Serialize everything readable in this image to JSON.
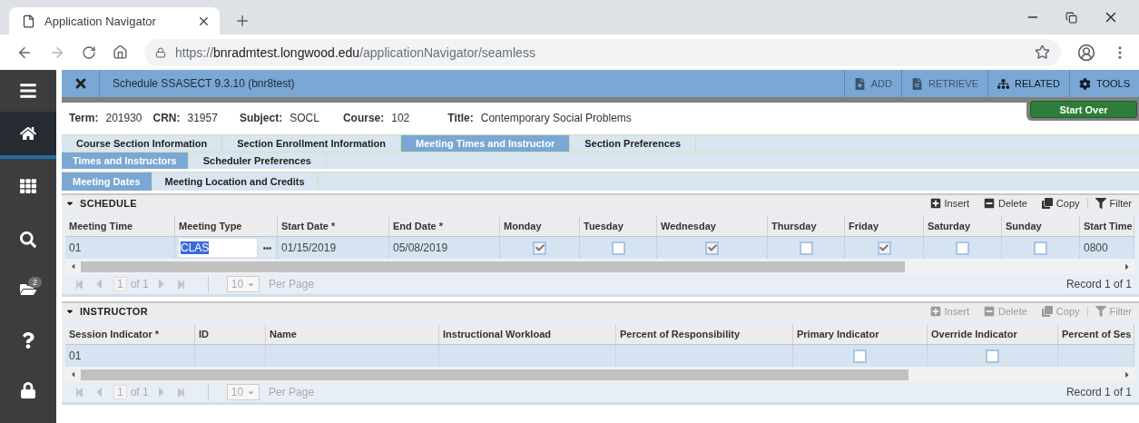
{
  "browser": {
    "tab_title": "Application Navigator",
    "url": {
      "scheme": "https://",
      "host": "bnradmtest.longwood.edu",
      "path": "/applicationNavigator/seamless"
    },
    "forward_disabled": true
  },
  "sidebar": [
    {
      "kind": "menu",
      "selected": false
    },
    {
      "kind": "home",
      "selected": true
    },
    {
      "kind": "apps",
      "selected": false
    },
    {
      "kind": "search",
      "selected": false
    },
    {
      "kind": "recent",
      "selected": false,
      "badge": "2"
    },
    {
      "kind": "help",
      "selected": false
    },
    {
      "kind": "signout",
      "selected": false
    }
  ],
  "app": {
    "title": "Schedule SSASECT 9.3.10 (bnr8test)",
    "actions": [
      {
        "kind": "add",
        "label": "ADD",
        "disabled": true
      },
      {
        "kind": "retrieve",
        "label": "RETRIEVE",
        "disabled": true
      },
      {
        "kind": "related",
        "label": "RELATED",
        "disabled": false
      },
      {
        "kind": "tools",
        "label": "TOOLS",
        "disabled": false
      }
    ]
  },
  "start_over": "Start Over",
  "key_block": [
    {
      "label": "Term:",
      "value": "201930"
    },
    {
      "label": "CRN:",
      "value": "31957"
    },
    {
      "label": "Subject:",
      "value": "SOCL"
    },
    {
      "label": "Course:",
      "value": "102"
    },
    {
      "label": "Title:",
      "value": "Contemporary Social Problems"
    }
  ],
  "tab_rows": [
    [
      {
        "label": "Course Section Information",
        "selected": false
      },
      {
        "label": "Section Enrollment Information",
        "selected": false
      },
      {
        "label": "Meeting Times and Instructor",
        "selected": true
      },
      {
        "label": "Section Preferences",
        "selected": false
      }
    ],
    [
      {
        "label": "Times and Instructors",
        "selected": true
      },
      {
        "label": "Scheduler Preferences",
        "selected": false
      }
    ],
    [
      {
        "label": "Meeting Dates",
        "selected": true
      },
      {
        "label": "Meeting Location and Credits",
        "selected": false
      }
    ]
  ],
  "sections": [
    {
      "title": "SCHEDULE",
      "expanded": true,
      "tools": [
        {
          "kind": "insert",
          "label": "Insert",
          "disabled": false
        },
        {
          "kind": "delete",
          "label": "Delete",
          "disabled": false
        },
        {
          "kind": "copy",
          "label": "Copy",
          "disabled": false
        },
        {
          "kind": "filter",
          "label": "Filter",
          "disabled": false
        }
      ],
      "columns": [
        "Meeting Time",
        "Meeting Type",
        "Start Date *",
        "End Date *",
        "Monday",
        "Tuesday",
        "Wednesday",
        "Thursday",
        "Friday",
        "Saturday",
        "Sunday",
        "Start Time"
      ],
      "rows": [
        {
          "selected": true,
          "cells": [
            {
              "kind": "text",
              "value": "01"
            },
            {
              "kind": "lookup",
              "value": "CLAS"
            },
            {
              "kind": "text",
              "value": "01/15/2019"
            },
            {
              "kind": "text",
              "value": "05/08/2019"
            },
            {
              "kind": "checkbox",
              "checked": true
            },
            {
              "kind": "checkbox",
              "checked": false
            },
            {
              "kind": "checkbox",
              "checked": true
            },
            {
              "kind": "checkbox",
              "checked": false
            },
            {
              "kind": "checkbox",
              "checked": true
            },
            {
              "kind": "checkbox",
              "checked": false
            },
            {
              "kind": "checkbox",
              "checked": false
            },
            {
              "kind": "text",
              "value": "0800"
            }
          ]
        }
      ],
      "pager": {
        "page": "1",
        "of": "of 1",
        "per_page": "10",
        "per_page_label": "Per Page",
        "record": "Record 1 of 1"
      }
    },
    {
      "title": "INSTRUCTOR",
      "expanded": true,
      "tools": [
        {
          "kind": "insert",
          "label": "Insert",
          "disabled": true
        },
        {
          "kind": "delete",
          "label": "Delete",
          "disabled": true
        },
        {
          "kind": "copy",
          "label": "Copy",
          "disabled": true
        },
        {
          "kind": "filter",
          "label": "Filter",
          "disabled": true
        }
      ],
      "columns": [
        "Session Indicator *",
        "ID",
        "Name",
        "Instructional Workload",
        "Percent of Responsibility",
        "Primary Indicator",
        "Override Indicator",
        "Percent of Ses"
      ],
      "rows": [
        {
          "selected": true,
          "cells": [
            {
              "kind": "text",
              "value": "01"
            },
            {
              "kind": "empty"
            },
            {
              "kind": "empty"
            },
            {
              "kind": "empty"
            },
            {
              "kind": "empty"
            },
            {
              "kind": "checkbox",
              "checked": false
            },
            {
              "kind": "checkbox",
              "checked": false
            },
            {
              "kind": "empty"
            }
          ]
        }
      ],
      "pager": {
        "page": "1",
        "of": "of 1",
        "per_page": "10",
        "per_page_label": "Per Page",
        "record": "Record 1 of 1"
      }
    }
  ]
}
